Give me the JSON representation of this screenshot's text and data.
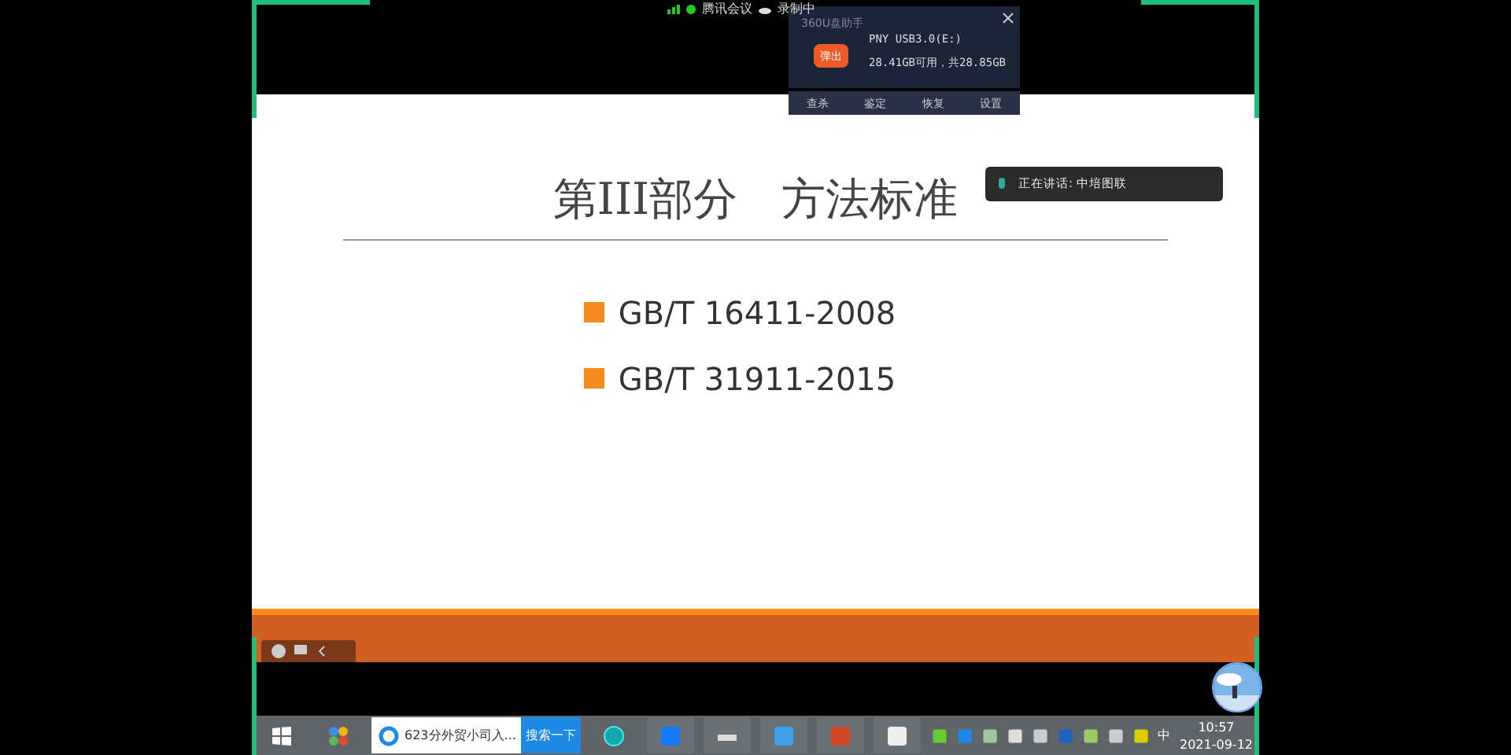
{
  "meeting_bar": {
    "app": "腾讯会议",
    "recording": "录制中"
  },
  "usb_popup": {
    "title": "360U盘助手",
    "eject": "弹出",
    "drive": "PNY USB3.0(E:)",
    "space": "28.41GB可用，共28.85GB",
    "actions": [
      "查杀",
      "鉴定",
      "恢复",
      "设置"
    ]
  },
  "speaking": {
    "text": "正在讲话: 中培图联"
  },
  "slide": {
    "title": "第III部分　方法标准",
    "bullets": [
      "GB/T 16411-2008",
      "GB/T 31911-2015"
    ]
  },
  "taskbar": {
    "search_value": "623分外贸小司入...",
    "search_button": "搜索一下",
    "ime": "中",
    "time": "10:57",
    "date": "2021-09-12"
  }
}
